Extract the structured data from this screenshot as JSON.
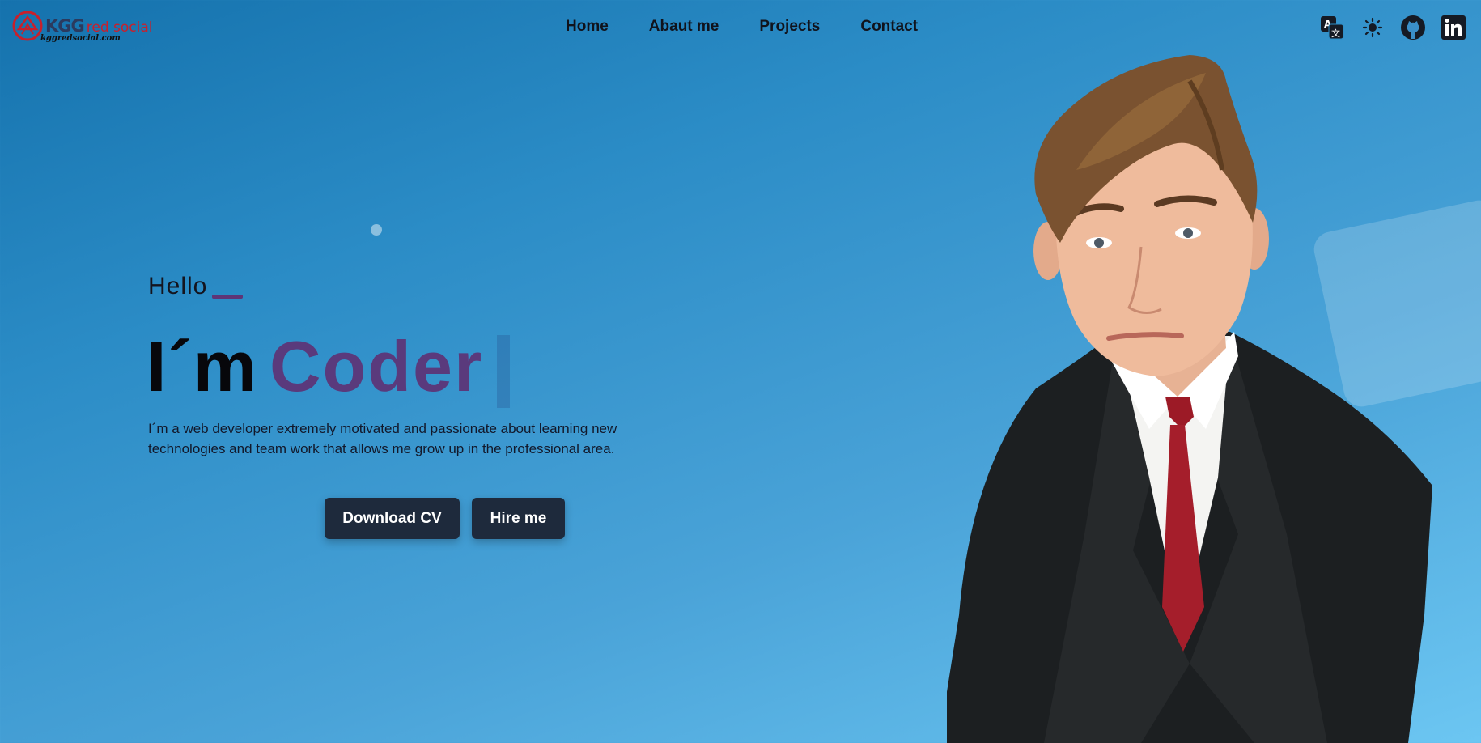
{
  "logo": {
    "brand": "KGG",
    "brand_suffix": "red social",
    "url": "kggredsocial.com",
    "mark_color": "#c8202c"
  },
  "nav": {
    "items": [
      "Home",
      "Abaut me",
      "Projects",
      "Contact"
    ]
  },
  "header_icons": [
    "translate-icon",
    "sun-icon",
    "github-icon",
    "linkedin-icon"
  ],
  "hero": {
    "greeting": "Hello",
    "headline_prefix": "I´m",
    "headline_word": "Coder",
    "description": "I´m a web developer extremely motivated and passionate about learning new technologies and team work that allows me grow up in the professional area.",
    "buttons": {
      "download": "Download CV",
      "hire": "Hire me"
    }
  },
  "colors": {
    "accent": "#5a3a7c",
    "button": "#1e2a3c",
    "bg_start": "#1572ad",
    "bg_end": "#6cc6f2"
  }
}
